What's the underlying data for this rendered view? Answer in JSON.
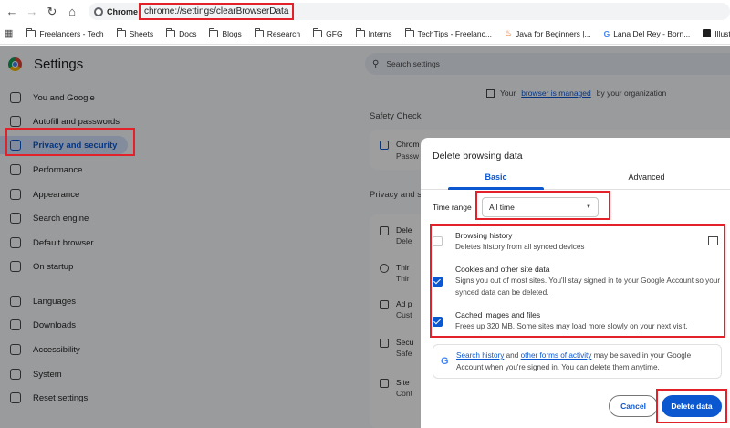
{
  "browser": {
    "chip_label": "Chrome",
    "url": "chrome://settings/clearBrowserData",
    "bookmarks": [
      {
        "label": "Freelancers - Tech",
        "icon": "folder-icon"
      },
      {
        "label": "Sheets",
        "icon": "folder-icon"
      },
      {
        "label": "Docs",
        "icon": "folder-icon"
      },
      {
        "label": "Blogs",
        "icon": "folder-icon"
      },
      {
        "label": "Research",
        "icon": "folder-icon"
      },
      {
        "label": "GFG",
        "icon": "folder-icon"
      },
      {
        "label": "Interns",
        "icon": "folder-icon"
      },
      {
        "label": "TechTips - Freelanc...",
        "icon": "folder-icon"
      },
      {
        "label": "Java for Beginners |...",
        "icon": "site-icon"
      },
      {
        "label": "Lana Del Rey - Born...",
        "icon": "google-icon"
      },
      {
        "label": "Illustration",
        "icon": "site-icon"
      }
    ]
  },
  "settings": {
    "title": "Settings",
    "search_placeholder": "Search settings",
    "managed_prefix": "Your",
    "managed_link": "browser is managed",
    "managed_suffix": "by your organization",
    "sidebar": [
      {
        "label": "You and Google"
      },
      {
        "label": "Autofill and passwords"
      },
      {
        "label": "Privacy and security"
      },
      {
        "label": "Performance"
      },
      {
        "label": "Appearance"
      },
      {
        "label": "Search engine"
      },
      {
        "label": "Default browser"
      },
      {
        "label": "On startup"
      },
      {
        "label": "Languages"
      },
      {
        "label": "Downloads"
      },
      {
        "label": "Accessibility"
      },
      {
        "label": "System"
      },
      {
        "label": "Reset settings"
      }
    ],
    "safety_check_heading": "Safety Check",
    "safety_card_title": "Chrom",
    "safety_card_sub": "Passw",
    "privacy_heading": "Privacy and s",
    "privacy_rows": [
      {
        "title": "Dele",
        "sub": "Dele"
      },
      {
        "title": "Thir",
        "sub": "Thir"
      },
      {
        "title": "Ad p",
        "sub": "Cust"
      },
      {
        "title": "Secu",
        "sub": "Safe"
      },
      {
        "title": "Site",
        "sub": "Cont"
      }
    ]
  },
  "dialog": {
    "title": "Delete browsing data",
    "tabs": {
      "basic": "Basic",
      "advanced": "Advanced"
    },
    "time_range_label": "Time range",
    "time_range_value": "All time",
    "options": [
      {
        "title": "Browsing history",
        "desc": "Deletes history from all synced devices",
        "checked": false
      },
      {
        "title": "Cookies and other site data",
        "desc": "Signs you out of most sites. You'll stay signed in to your Google Account so your synced data can be deleted.",
        "checked": true
      },
      {
        "title": "Cached images and files",
        "desc": "Frees up 320 MB. Some sites may load more slowly on your next visit.",
        "checked": true
      }
    ],
    "info": {
      "link1": "Search history",
      "mid": "and",
      "link2": "other forms of activity",
      "rest": "may be saved in your Google Account when you're signed in. You can delete them anytime."
    },
    "cancel_label": "Cancel",
    "delete_label": "Delete data"
  },
  "colors": {
    "accent": "#0b57d0",
    "highlight_box": "#e3212b"
  }
}
